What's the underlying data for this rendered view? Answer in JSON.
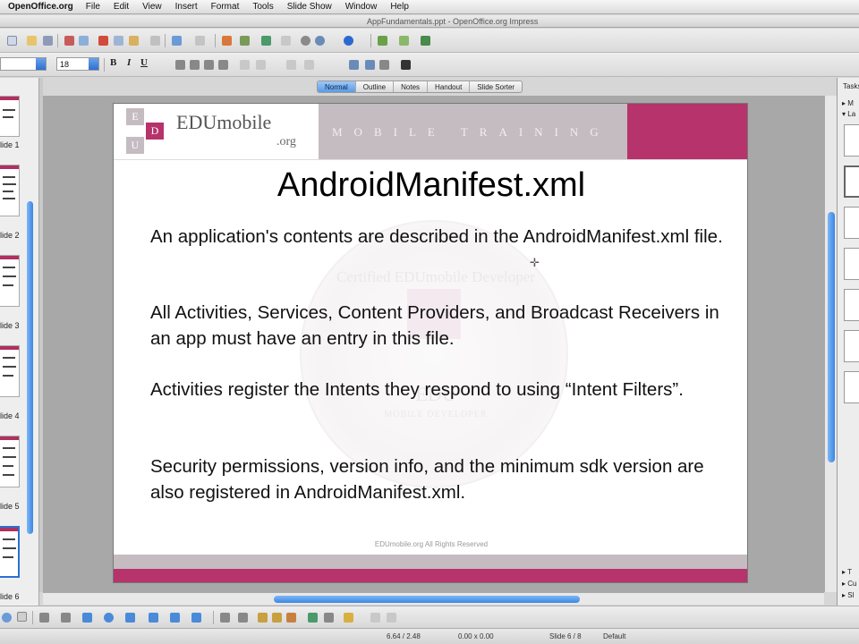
{
  "menubar": {
    "app_name": "OpenOffice.org",
    "menus": [
      "File",
      "Edit",
      "View",
      "Insert",
      "Format",
      "Tools",
      "Slide Show",
      "Window",
      "Help"
    ]
  },
  "window": {
    "title": "AppFundamentals.ppt - OpenOffice.org Impress"
  },
  "format_toolbar": {
    "font_name": "",
    "font_size": "18",
    "bold_label": "B",
    "italic_label": "I",
    "underline_label": "U"
  },
  "view_tabs": [
    {
      "label": "Normal",
      "active": true
    },
    {
      "label": "Outline",
      "active": false
    },
    {
      "label": "Notes",
      "active": false
    },
    {
      "label": "Handout",
      "active": false
    },
    {
      "label": "Slide Sorter",
      "active": false
    }
  ],
  "slide_pane": {
    "thumbnail_labels": [
      "lide 1",
      "lide 2",
      "lide 3",
      "lide 4",
      "lide 5",
      "lide 6"
    ],
    "active_index": 5
  },
  "slide": {
    "logo_letters": [
      "E",
      "D",
      "U"
    ],
    "logo_text": "EDUmobile",
    "logo_sub": ".org",
    "tagline": "MOBILE TRAINING",
    "title": "AndroidManifest.xml",
    "bullets": [
      "An application's contents are described in the AndroidManifest.xml file.",
      "All Activities, Services, Content Providers, and Broadcast Receivers in an app must have an entry in this file.",
      "Activities register the Intents they respond to using “Intent Filters”.",
      "Security permissions, version info, and the minimum sdk version are also registered in AndroidManifest.xml."
    ],
    "footer": "EDUmobile.org All Rights Reserved",
    "watermark_main": "Certified EDUmobile Developer",
    "watermark_edu": "EDU",
    "watermark_sub": "MOBILE DEVELOPER"
  },
  "task_pane": {
    "title": "Tasks",
    "items_top": [
      "▸ M",
      "▾ La"
    ],
    "items_bottom": [
      "▸ T",
      "▸ Cu",
      "▸ Sl"
    ]
  },
  "status": {
    "position": "6.64 / 2.48",
    "size": "0.00 x 0.00",
    "slide": "Slide 6 / 8",
    "layout": "Default"
  },
  "colors": {
    "accent_magenta": "#b6336b",
    "header_gray": "#c4bcc1",
    "selection_blue": "#3b86e3"
  }
}
